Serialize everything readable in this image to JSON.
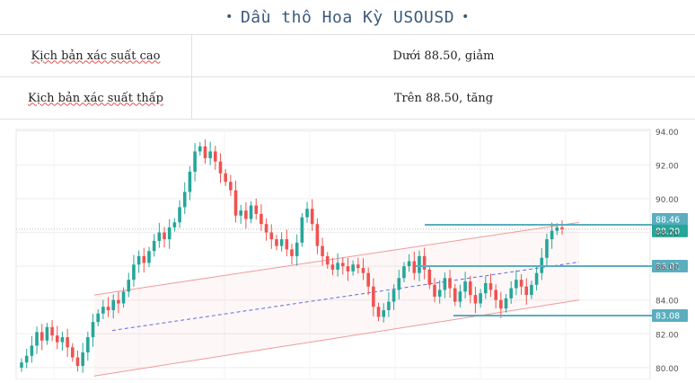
{
  "header": {
    "bullet_left": "•",
    "title": "Dầu thô Hoa Kỳ USOUSD",
    "bullet_right": "•"
  },
  "scenarios": [
    {
      "label": "Kịch bản xác suất cao",
      "value": "Dưới 88.50, giảm"
    },
    {
      "label": "Kịch bản xác suất thấp",
      "value": "Trên 88.50, tăng"
    }
  ],
  "chart_data": {
    "type": "candlestick",
    "y_ticks": [
      "94.00",
      "92.00",
      "90.00",
      "88.00",
      "86.00",
      "84.00",
      "82.00",
      "80.00"
    ],
    "ylim": [
      79.3,
      94.1
    ],
    "grid": true,
    "colors": {
      "up": "#26a69a",
      "down": "#ef5350",
      "level": "#5aaebe",
      "channel": "#ef9a9a",
      "midline": "#5b6ee1"
    },
    "level_labels": [
      {
        "text": "88.46",
        "value": 88.46,
        "fill": "#5aaebe"
      },
      {
        "text": "88.20",
        "value": 88.2,
        "fill": "#26a69a"
      },
      {
        "text": "86.01",
        "value": 86.01,
        "fill": "#5aaebe"
      },
      {
        "text": "83.08",
        "value": 83.08,
        "fill": "#5aaebe"
      }
    ],
    "closes": [
      80.3,
      80.7,
      81.3,
      82.1,
      81.6,
      82.4,
      81.9,
      81.5,
      81.8,
      81.2,
      80.6,
      80.1,
      80.9,
      81.8,
      82.7,
      83.2,
      83.6,
      83.4,
      84.0,
      83.8,
      84.5,
      85.2,
      86.1,
      86.6,
      86.2,
      86.9,
      87.5,
      88.0,
      87.6,
      88.3,
      88.6,
      89.5,
      90.4,
      91.6,
      92.8,
      93.1,
      92.4,
      92.8,
      92.2,
      91.5,
      91.0,
      90.5,
      89.0,
      89.3,
      88.8,
      89.6,
      89.1,
      88.5,
      88.0,
      87.6,
      87.2,
      87.6,
      87.0,
      86.6,
      87.4,
      88.9,
      89.4,
      88.5,
      87.2,
      86.6,
      86.1,
      85.8,
      86.2,
      86.0,
      85.7,
      86.1,
      85.9,
      85.6,
      84.8,
      83.6,
      83.0,
      83.4,
      83.9,
      84.6,
      85.3,
      86.0,
      86.3,
      85.6,
      86.6,
      85.8,
      84.9,
      84.2,
      84.6,
      85.3,
      84.7,
      83.9,
      84.5,
      85.1,
      84.3,
      83.8,
      84.4,
      85.0,
      84.6,
      84.0,
      83.5,
      84.1,
      84.7,
      85.2,
      84.8,
      84.3,
      84.9,
      85.6,
      86.5,
      87.6,
      88.1,
      88.3,
      88.2
    ]
  }
}
